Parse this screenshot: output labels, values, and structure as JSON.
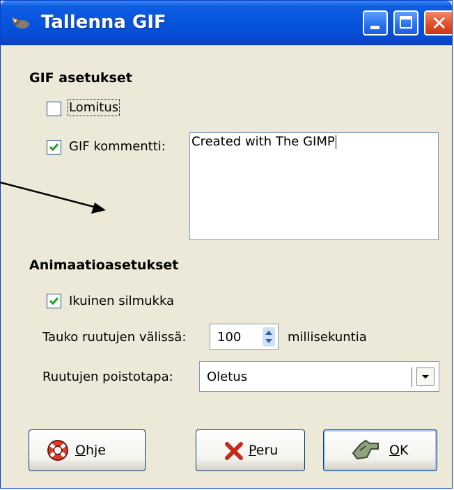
{
  "window": {
    "title": "Tallenna GIF"
  },
  "gif_settings": {
    "heading": "GIF asetukset",
    "interlace": {
      "label": "Lomitus",
      "checked": false
    },
    "comment": {
      "label": "GIF kommentti:",
      "checked": true,
      "value": "Created with The GIMP"
    }
  },
  "animation": {
    "heading": "Animaatioasetukset",
    "loop": {
      "label": "Ikuinen silmukka",
      "checked": true
    },
    "delay": {
      "label": "Tauko ruutujen välissä:",
      "value": "100",
      "unit": "millisekuntia"
    },
    "disposal": {
      "label": "Ruutujen poistotapa:",
      "value": "Oletus"
    }
  },
  "buttons": {
    "help": {
      "mnemonic": "O",
      "rest": "hje"
    },
    "cancel": {
      "mnemonic": "P",
      "rest": "eru"
    },
    "ok": {
      "mnemonic": "O",
      "rest": "K"
    }
  }
}
